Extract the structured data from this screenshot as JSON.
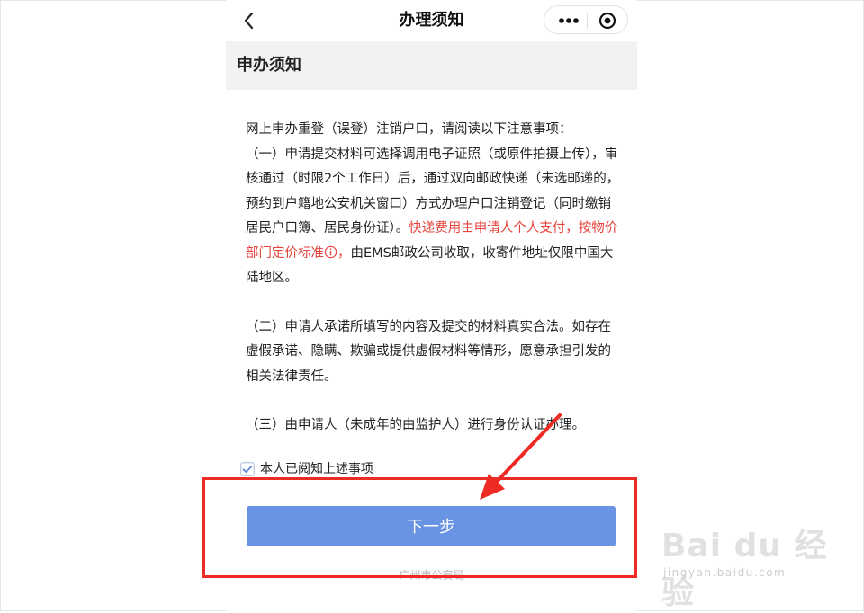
{
  "nav": {
    "title": "办理须知",
    "back_icon": "chevron-left-icon",
    "more_icon": "more-dots-icon",
    "close_icon": "target-close-icon"
  },
  "section": {
    "title": "申办须知"
  },
  "notice": {
    "intro": "网上申办重登（误登）注销户口，请阅读以下注意事项：",
    "item1_before": "（一）申请提交材料可选择调用电子证照（或原件拍摄上传），审核通过（时限2个工作日）后，通过双向邮政快递（未选邮递的，预约到户籍地公安机关窗口）方式办理户口注销登记（同时缴销居民户口簿、居民身份证）。",
    "item1_red": "快递费用由申请人个人支付，按物价部门定价标准",
    "item1_red_tail": "，",
    "item1_after": "由EMS邮政公司收取，收寄件地址仅限中国大陆地区。",
    "item2": "（二）申请人承诺所填写的内容及提交的材料真实合法。如存在虚假承诺、隐瞒、欺骗或提供虚假材料等情形，愿意承担引发的相关法律责任。",
    "item3": "（三）由申请人（未成年的由监护人）进行身份认证办理。"
  },
  "agreement": {
    "label": "本人已阅知上述事项",
    "checked": true
  },
  "actions": {
    "next_label": "下一步"
  },
  "footer": {
    "text": "广州市公安局"
  },
  "watermark": {
    "brand": "Bai du 经验",
    "url": "jingyan.baidu.com"
  },
  "colors": {
    "accent": "#6993e3",
    "warning_text": "#e6423b",
    "highlight": "#ee2a24"
  }
}
